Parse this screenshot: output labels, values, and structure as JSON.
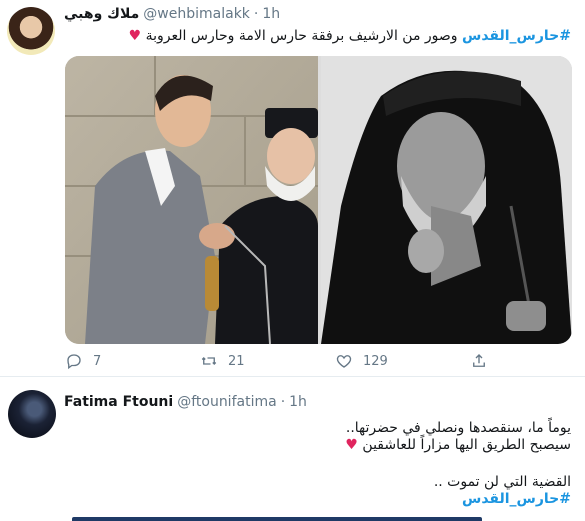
{
  "tweet1": {
    "display_name": "ملاك وهبي",
    "handle": "@wehbimalakk",
    "separator": "·",
    "time": "1h",
    "text": {
      "hashtag": "#حارس_القدس",
      "body": "وصور من الارشيف برفقة حارس الامة وحارس العروبة",
      "emoji": "♥"
    },
    "actions": {
      "replies": "7",
      "retweets": "21",
      "likes": "129"
    }
  },
  "tweet2": {
    "display_name": "Fatima Ftouni",
    "handle": "@ftounifatima",
    "separator": "·",
    "time": "1h",
    "text": {
      "line1": "يوماً ما، سنقصدها ونصلي في حضرتها..",
      "line2": "سيصبح الطريق اليها مزاراً للعاشقين",
      "line2_emoji": "♥",
      "line3": "القضية التي لن تموت ..",
      "hashtag": "#حارس_القدس"
    }
  },
  "colors": {
    "hashtag": "#1b95e0",
    "heart": "#e0245e",
    "muted": "#657786"
  },
  "icons": {
    "reply": "reply-icon",
    "retweet": "retweet-icon",
    "like": "heart-icon",
    "share": "share-icon"
  }
}
